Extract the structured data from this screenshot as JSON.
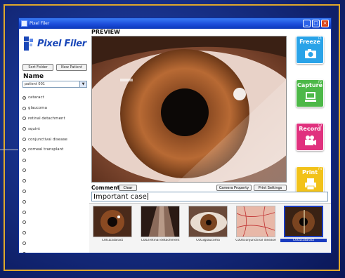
{
  "window": {
    "title": "Pixel Filer",
    "minimize_glyph": "_",
    "maximize_glyph": "□",
    "close_glyph": "×"
  },
  "logo": {
    "text": "Pixel Filer"
  },
  "sidebar": {
    "btn_left_label": "Sort Folder",
    "btn_right_label": "New Patient",
    "name_label": "Name",
    "name_value": "patient 001",
    "name_arrow": "▼",
    "categories": [
      {
        "label": "cataract",
        "checked": true
      },
      {
        "label": "glaucoma",
        "checked": false
      },
      {
        "label": "retinal detachment",
        "checked": false
      },
      {
        "label": "squint",
        "checked": false
      },
      {
        "label": "conjunctival disease",
        "checked": false
      },
      {
        "label": "corneal transplant",
        "checked": false
      },
      {
        "label": "",
        "checked": false
      },
      {
        "label": "",
        "checked": false
      },
      {
        "label": "",
        "checked": false
      },
      {
        "label": "",
        "checked": false
      },
      {
        "label": "",
        "checked": false
      },
      {
        "label": "",
        "checked": false
      },
      {
        "label": "",
        "checked": false
      },
      {
        "label": "",
        "checked": false
      },
      {
        "label": "",
        "checked": false
      },
      {
        "label": "",
        "checked": false
      }
    ]
  },
  "preview": {
    "label": "PREVIEW"
  },
  "actions": {
    "freeze": {
      "label": "Freeze",
      "key": "F1",
      "color": "#2aa3e8",
      "icon": "camera-icon"
    },
    "capture": {
      "label": "Capture",
      "key": "F2",
      "color": "#4db848",
      "icon": "computer-icon"
    },
    "record": {
      "label": "Record",
      "key": "F3",
      "color": "#e0317e",
      "icon": "video-camera-icon"
    },
    "print": {
      "label": "Print",
      "key": "F4",
      "color": "#f2c21a",
      "icon": "printer-icon"
    }
  },
  "comment": {
    "label": "Comment",
    "clear_label": "Clear",
    "camera_property_label": "Camera Property",
    "print_settings_label": "Print Settings",
    "value": "Important case"
  },
  "thumbnails": [
    {
      "caption": "C001cataract",
      "selected": false
    },
    {
      "caption": "C002retinal detachment",
      "selected": false
    },
    {
      "caption": "C003glaucoma",
      "selected": false
    },
    {
      "caption": "C004conjunctival disease",
      "selected": false
    },
    {
      "caption": "C005cataract",
      "selected": true
    }
  ]
}
